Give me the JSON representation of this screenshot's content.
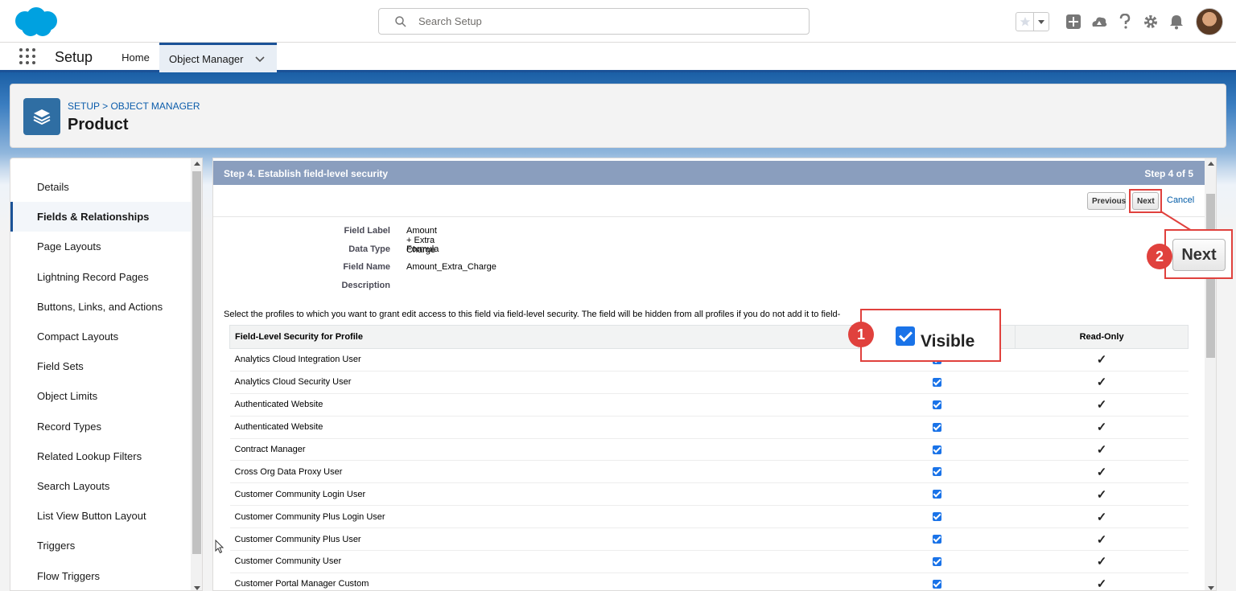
{
  "colors": {
    "brand_blue": "#1b5297",
    "step_bar": "#8a9ebe",
    "annotation_red": "#e0413d",
    "checkbox_blue": "#1a73e8",
    "link_blue": "#0b5cab"
  },
  "header": {
    "search_placeholder": "Search Setup",
    "icons": [
      "favorites-star-icon",
      "favorites-dropdown-icon",
      "add-icon",
      "trailhead-icon",
      "help-icon",
      "setup-gear-icon",
      "notifications-bell-icon",
      "user-avatar"
    ]
  },
  "nav": {
    "app_name": "Setup",
    "tabs": [
      {
        "label": "Home"
      },
      {
        "label": "Object Manager"
      }
    ]
  },
  "object": {
    "breadcrumb": "SETUP > OBJECT MANAGER",
    "title": "Product"
  },
  "sidebar": {
    "items": [
      {
        "label": "Details"
      },
      {
        "label": "Fields & Relationships"
      },
      {
        "label": "Page Layouts"
      },
      {
        "label": "Lightning Record Pages"
      },
      {
        "label": "Buttons, Links, and Actions"
      },
      {
        "label": "Compact Layouts"
      },
      {
        "label": "Field Sets"
      },
      {
        "label": "Object Limits"
      },
      {
        "label": "Record Types"
      },
      {
        "label": "Related Lookup Filters"
      },
      {
        "label": "Search Layouts"
      },
      {
        "label": "List View Button Layout"
      },
      {
        "label": "Triggers"
      },
      {
        "label": "Flow Triggers"
      }
    ],
    "active_index": 1
  },
  "step": {
    "title": "Step 4. Establish field-level security",
    "count": "Step 4 of 5",
    "previous_label": "Previous",
    "next_label": "Next",
    "cancel_label": "Cancel"
  },
  "field": {
    "rows": [
      {
        "label": "Field Label",
        "value": "Amount + Extra Charge"
      },
      {
        "label": "Data Type",
        "value": "Formula"
      },
      {
        "label": "Field Name",
        "value": "Amount_Extra_Charge"
      },
      {
        "label": "Description",
        "value": ""
      }
    ]
  },
  "info_text": "Select the profiles to which you want to grant edit access to this field via field-level security. The field will be hidden from all profiles if you do not add it to field-",
  "table": {
    "headers": {
      "profile": "Field-Level Security for Profile",
      "visible": "",
      "read_only": "Read-Only"
    },
    "rows": [
      {
        "profile": "Analytics Cloud Integration User",
        "visible": true,
        "read_only": true
      },
      {
        "profile": "Analytics Cloud Security User",
        "visible": true,
        "read_only": true
      },
      {
        "profile": "Authenticated Website",
        "visible": true,
        "read_only": true
      },
      {
        "profile": "Authenticated Website",
        "visible": true,
        "read_only": true
      },
      {
        "profile": "Contract Manager",
        "visible": true,
        "read_only": true
      },
      {
        "profile": "Cross Org Data Proxy User",
        "visible": true,
        "read_only": true
      },
      {
        "profile": "Customer Community Login User",
        "visible": true,
        "read_only": true
      },
      {
        "profile": "Customer Community Plus Login User",
        "visible": true,
        "read_only": true
      },
      {
        "profile": "Customer Community Plus User",
        "visible": true,
        "read_only": true
      },
      {
        "profile": "Customer Community User",
        "visible": true,
        "read_only": true
      },
      {
        "profile": "Customer Portal Manager Custom",
        "visible": true,
        "read_only": true
      }
    ],
    "read_only_glyph": "✓"
  },
  "annotations": {
    "badge_1": "1",
    "badge_2": "2",
    "visible_label": "Visible",
    "next_label": "Next"
  }
}
